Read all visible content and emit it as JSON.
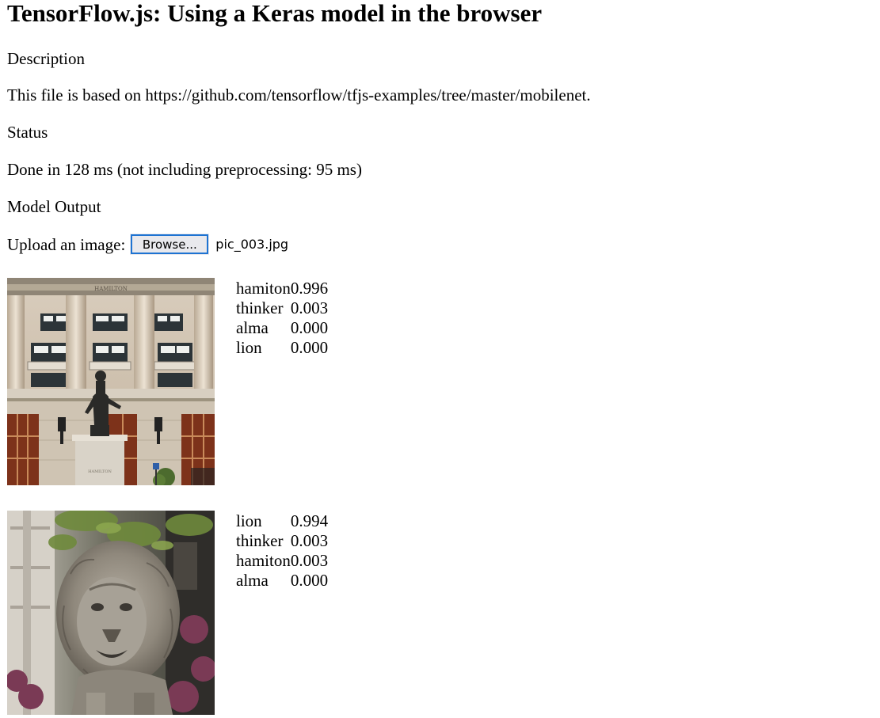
{
  "page": {
    "title": "TensorFlow.js: Using a Keras model in the browser",
    "description_heading": "Description",
    "description_text": "This file is based on https://github.com/tensorflow/tfjs-examples/tree/master/mobilenet.",
    "status_heading": "Status",
    "status_text": "Done in 128 ms (not including preprocessing: 95 ms)",
    "output_heading": "Model Output"
  },
  "upload": {
    "label": "Upload an image:",
    "button_label": "Browse...",
    "file_name": "pic_003.jpg"
  },
  "results": [
    {
      "image_icon": "hamilton-statue-photo",
      "predictions": [
        {
          "label": "hamiton",
          "score": "0.996"
        },
        {
          "label": "thinker",
          "score": "0.003"
        },
        {
          "label": "alma",
          "score": "0.000"
        },
        {
          "label": "lion",
          "score": "0.000"
        }
      ]
    },
    {
      "image_icon": "lion-statue-photo",
      "predictions": [
        {
          "label": "lion",
          "score": "0.994"
        },
        {
          "label": "thinker",
          "score": "0.003"
        },
        {
          "label": "hamiton",
          "score": "0.003"
        },
        {
          "label": "alma",
          "score": "0.000"
        }
      ]
    }
  ],
  "colors": {
    "button_border": "#1e73d2",
    "button_bg": "#e9e9ed",
    "building_stone": "#cdbfae",
    "door_wood": "#8a3a1e",
    "foliage": "#6f8a3c",
    "lion_stone": "#9b9488"
  }
}
